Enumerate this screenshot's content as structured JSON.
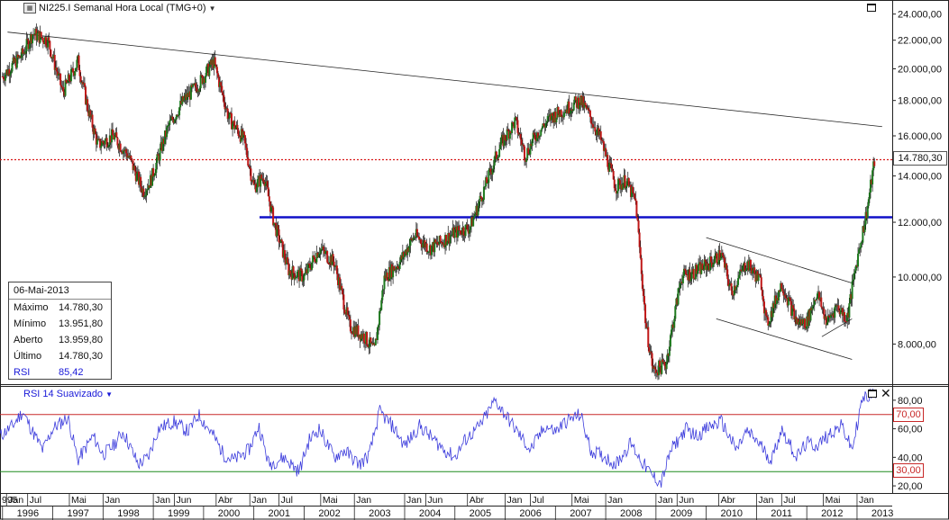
{
  "header": {
    "symbol_icon": "chart-symbol-icon",
    "title": "NI225.I Semanal Hora Local (TMG+0)",
    "dropdown_icon": "chevron-down-icon"
  },
  "rsi_header": {
    "title": "RSI 14 Suavizado",
    "dropdown_icon": "chevron-down-icon"
  },
  "info_box": {
    "date": "06-Mai-2013",
    "rows": [
      {
        "label": "Máximo",
        "value": "14.780,30"
      },
      {
        "label": "Mínimo",
        "value": "13.951,80"
      },
      {
        "label": "Aberto",
        "value": "13.959,80"
      },
      {
        "label": "Último",
        "value": "14.780,30"
      },
      {
        "label": "RSI",
        "value": "85,42"
      }
    ]
  },
  "badges": {
    "last_price": "14.780,30",
    "rsi_upper": "70,00",
    "rsi_lower": "30,00"
  },
  "colors": {
    "up": "#1e7a1e",
    "down": "#c01818",
    "blue_line": "#1010c8",
    "rsi_line": "#3c3cdc",
    "rsi_upper": "#c82828",
    "rsi_lower": "#1e8c1e",
    "last_dotted": "#d81818"
  },
  "chart_data": [
    {
      "type": "line",
      "description_kind": "weekly candlestick price",
      "y_scale": "log",
      "ylim": [
        7000,
        25000
      ],
      "x_range": [
        1995.95,
        2013.7
      ],
      "y_ticks": [
        {
          "value": 8000,
          "label": "8.000,00"
        },
        {
          "value": 10000,
          "label": "10.000,00"
        },
        {
          "value": 12000,
          "label": "12.000,00"
        },
        {
          "value": 14000,
          "label": "14.000,00"
        },
        {
          "value": 16000,
          "label": "16.000,00"
        },
        {
          "value": 18000,
          "label": "18.000,00"
        },
        {
          "value": 20000,
          "label": "20.000,00"
        },
        {
          "value": 22000,
          "label": "22.000,00"
        },
        {
          "value": 24000,
          "label": "24.000,00"
        }
      ],
      "series": [
        {
          "x": [
            1996.0,
            1996.4,
            1996.6,
            1996.9,
            1997.2,
            1997.5,
            1997.7,
            1997.9,
            1998.2,
            1998.5,
            1998.8,
            1998.95,
            1999.3,
            1999.6,
            1999.9,
            2000.2,
            2000.5,
            2000.8,
            2001.0,
            2001.2,
            2001.4,
            2001.7,
            2002.0,
            2002.3,
            2002.6,
            2002.9,
            2003.2,
            2003.4,
            2003.6,
            2003.9,
            2004.2,
            2004.5,
            2004.7,
            2005.0,
            2005.3,
            2005.6,
            2005.9,
            2006.2,
            2006.4,
            2006.6,
            2006.9,
            2007.2,
            2007.5,
            2007.7,
            2007.9,
            2008.2,
            2008.4,
            2008.6,
            2008.8,
            2008.95,
            2009.2,
            2009.5,
            2009.8,
            2010.1,
            2010.3,
            2010.5,
            2010.8,
            2011.1,
            2011.2,
            2011.5,
            2011.8,
            2012.0,
            2012.2,
            2012.4,
            2012.6,
            2012.8,
            2013.0,
            2013.2,
            2013.35
          ],
          "values": [
            19500,
            21000,
            22500,
            22000,
            18500,
            20500,
            17500,
            15500,
            16000,
            15000,
            13300,
            13800,
            16500,
            18000,
            19000,
            20500,
            17000,
            15800,
            13500,
            14000,
            12000,
            10200,
            10000,
            11000,
            10500,
            8500,
            8200,
            7800,
            10000,
            10500,
            11500,
            11000,
            11200,
            11600,
            11800,
            13500,
            15500,
            16800,
            15000,
            16000,
            17000,
            17500,
            18000,
            17000,
            15800,
            13500,
            13800,
            12800,
            8500,
            7300,
            7500,
            10000,
            10200,
            10500,
            10800,
            9500,
            10500,
            9800,
            8500,
            9800,
            8600,
            8600,
            9500,
            8600,
            9100,
            8700,
            10600,
            12500,
            14780
          ]
        }
      ],
      "annotations": {
        "horizontal_support": 12200,
        "last_price_level": 14780.3,
        "downtrend_line": {
          "from": [
            1996.1,
            22600
          ],
          "to": [
            2013.5,
            16500
          ]
        },
        "channel_upper": {
          "from": [
            2010.0,
            11400
          ],
          "to": [
            2012.9,
            9800
          ]
        },
        "channel_lower": {
          "from": [
            2010.2,
            8700
          ],
          "to": [
            2012.9,
            7600
          ]
        },
        "small_wedge": {
          "from": [
            2012.3,
            8200
          ],
          "to": [
            2012.9,
            8700
          ]
        }
      }
    },
    {
      "type": "line",
      "title": "RSI 14 Suavizado",
      "ylim": [
        15,
        90
      ],
      "y_ticks": [
        {
          "value": 20,
          "label": "20,00"
        },
        {
          "value": 40,
          "label": "40,00"
        },
        {
          "value": 60,
          "label": "60,00"
        },
        {
          "value": 80,
          "label": "80,00"
        }
      ],
      "levels": [
        70,
        30
      ],
      "series": [
        {
          "name": "RSI",
          "x": [
            1995.95,
            1996.2,
            1996.4,
            1996.6,
            1996.8,
            1997.0,
            1997.3,
            1997.5,
            1997.8,
            1998.0,
            1998.2,
            1998.4,
            1998.7,
            1998.9,
            1999.1,
            1999.4,
            1999.7,
            1999.9,
            2000.2,
            2000.4,
            2000.6,
            2000.9,
            2001.1,
            2001.3,
            2001.6,
            2001.9,
            2002.1,
            2002.3,
            2002.6,
            2002.8,
            2003.1,
            2003.3,
            2003.5,
            2003.8,
            2004.0,
            2004.3,
            2004.5,
            2004.8,
            2005.0,
            2005.2,
            2005.5,
            2005.8,
            2006.0,
            2006.3,
            2006.5,
            2006.8,
            2007.0,
            2007.2,
            2007.5,
            2007.7,
            2008.0,
            2008.2,
            2008.5,
            2008.7,
            2008.9,
            2009.1,
            2009.3,
            2009.6,
            2009.8,
            2010.1,
            2010.3,
            2010.6,
            2010.8,
            2011.0,
            2011.3,
            2011.5,
            2011.8,
            2012.0,
            2012.2,
            2012.5,
            2012.7,
            2012.9,
            2013.1,
            2013.3,
            2013.4
          ],
          "values": [
            55,
            62,
            72,
            58,
            45,
            60,
            68,
            38,
            55,
            42,
            48,
            58,
            35,
            40,
            60,
            65,
            58,
            70,
            55,
            42,
            38,
            45,
            62,
            35,
            40,
            30,
            52,
            60,
            40,
            45,
            35,
            42,
            72,
            60,
            48,
            62,
            55,
            45,
            40,
            52,
            62,
            80,
            70,
            55,
            45,
            62,
            58,
            65,
            70,
            45,
            40,
            35,
            50,
            38,
            28,
            22,
            45,
            60,
            55,
            62,
            65,
            45,
            58,
            52,
            38,
            60,
            40,
            50,
            48,
            58,
            62,
            45,
            80,
            85,
            82
          ]
        }
      ]
    }
  ],
  "x_axis": {
    "years": [
      "1996",
      "1997",
      "1998",
      "1999",
      "2000",
      "2001",
      "2002",
      "2003",
      "2004",
      "2005",
      "2006",
      "2007",
      "2008",
      "2009",
      "2010",
      "2011",
      "2012",
      "2013"
    ],
    "months": [
      {
        "x": 1995.95,
        "label": "995"
      },
      {
        "x": 1996.08,
        "label": "Jan"
      },
      {
        "x": 1996.5,
        "label": "Jul"
      },
      {
        "x": 1997.33,
        "label": "Mai"
      },
      {
        "x": 1998.0,
        "label": "Jan"
      },
      {
        "x": 1999.0,
        "label": "Jan"
      },
      {
        "x": 1999.42,
        "label": "Jun"
      },
      {
        "x": 2000.25,
        "label": "Abr"
      },
      {
        "x": 2000.92,
        "label": "Jan"
      },
      {
        "x": 2001.5,
        "label": "Jul"
      },
      {
        "x": 2002.33,
        "label": "Mai"
      },
      {
        "x": 2003.0,
        "label": "Jan"
      },
      {
        "x": 2004.0,
        "label": "Jan"
      },
      {
        "x": 2004.42,
        "label": "Jun"
      },
      {
        "x": 2005.25,
        "label": "Abr"
      },
      {
        "x": 2006.0,
        "label": "Jan"
      },
      {
        "x": 2006.5,
        "label": "Jul"
      },
      {
        "x": 2007.33,
        "label": "Mai"
      },
      {
        "x": 2008.0,
        "label": "Jan"
      },
      {
        "x": 2009.0,
        "label": "Jan"
      },
      {
        "x": 2009.42,
        "label": "Jun"
      },
      {
        "x": 2010.25,
        "label": "Abr"
      },
      {
        "x": 2011.0,
        "label": "Jan"
      },
      {
        "x": 2011.5,
        "label": "Jul"
      },
      {
        "x": 2012.33,
        "label": "Mai"
      },
      {
        "x": 2013.0,
        "label": "Jan"
      }
    ]
  }
}
